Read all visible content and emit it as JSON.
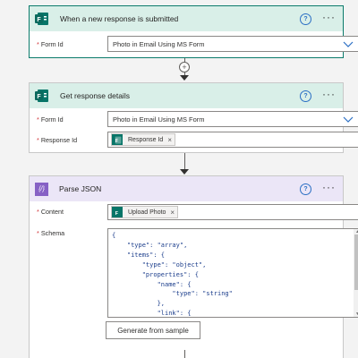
{
  "trigger": {
    "title": "When a new response is submitted",
    "fields": [
      {
        "label": "Form Id",
        "required_mark": "*",
        "value": "Photo in Email Using MS Form"
      }
    ]
  },
  "get_details": {
    "title": "Get response details",
    "fields": [
      {
        "label": "Form Id",
        "required_mark": "*",
        "value": "Photo in Email Using MS Form"
      },
      {
        "label": "Response Id",
        "required_mark": "*",
        "token": "Response Id",
        "token_remove": "×"
      }
    ]
  },
  "parse_json": {
    "title": "Parse JSON",
    "content": {
      "label": "Content",
      "required_mark": "*",
      "token": "Upload Photo",
      "token_remove": "×"
    },
    "schema": {
      "label": "Schema",
      "required_mark": "*",
      "text": "{\n    \"type\": \"array\",\n    \"items\": {\n        \"type\": \"object\",\n        \"properties\": {\n            \"name\": {\n                \"type\": \"string\"\n            },\n            \"link\": {\n                \"type\": \"string\""
    },
    "generate_button": "Generate from sample"
  },
  "common": {
    "help_symbol": "?",
    "more_symbol": "···",
    "add_symbol": "+"
  },
  "colors": {
    "forms_header": "#d9efe8",
    "forms_brand": "#077568",
    "json_header": "#ebe6f7",
    "json_brand": "#8661c5",
    "trigger_border": "#0b7b6b"
  }
}
